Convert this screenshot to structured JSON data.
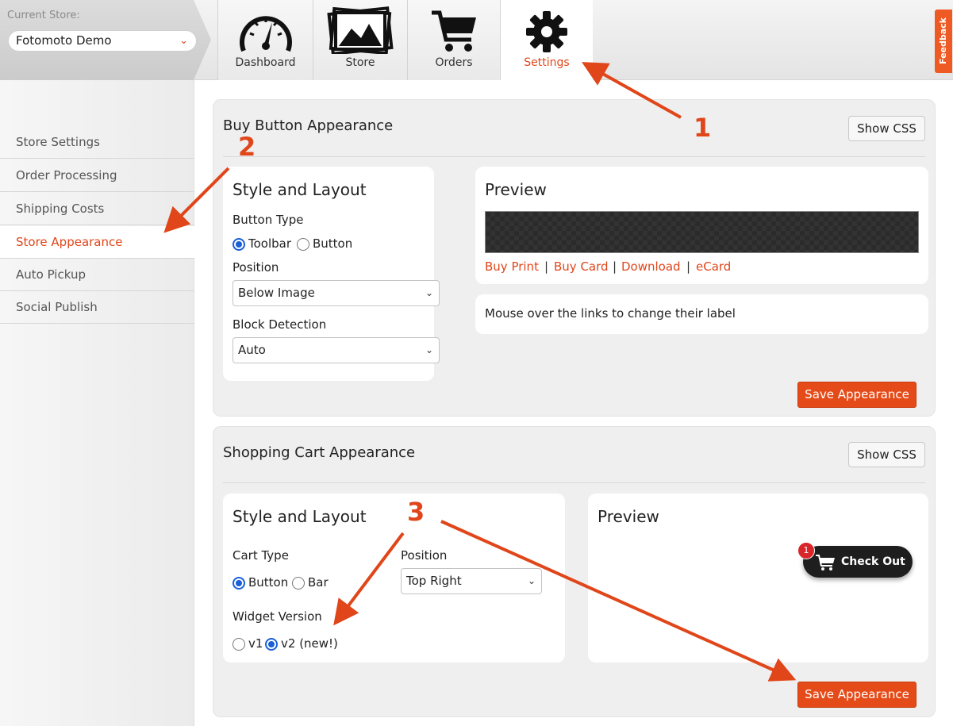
{
  "header": {
    "store_caption": "Current Store:",
    "store_name": "Fotomoto Demo",
    "tabs": [
      {
        "label": "Dashboard",
        "icon": "dashboard-gauge-icon"
      },
      {
        "label": "Store",
        "icon": "photos-icon"
      },
      {
        "label": "Orders",
        "icon": "cart-icon"
      },
      {
        "label": "Settings",
        "icon": "gear-icon"
      }
    ],
    "active_tab": "Settings",
    "feedback_label": "Feedback"
  },
  "sidebar": {
    "items": [
      {
        "label": "Store Settings"
      },
      {
        "label": "Order Processing"
      },
      {
        "label": "Shipping Costs"
      },
      {
        "label": "Store Appearance"
      },
      {
        "label": "Auto Pickup"
      },
      {
        "label": "Social Publish"
      }
    ],
    "active_item": "Store Appearance"
  },
  "buy_button": {
    "title": "Buy Button Appearance",
    "show_css_label": "Show CSS",
    "style_title": "Style and Layout",
    "button_type_label": "Button Type",
    "button_type_options": [
      "Toolbar",
      "Button"
    ],
    "button_type_selected": "Toolbar",
    "position_label": "Position",
    "position_value": "Below Image",
    "block_detection_label": "Block Detection",
    "block_detection_value": "Auto",
    "preview_title": "Preview",
    "preview_links": [
      "Buy Print",
      "Buy Card",
      "Download",
      "eCard"
    ],
    "link_separator": "|",
    "hint": "Mouse over the links to change their label",
    "save_label": "Save Appearance"
  },
  "cart": {
    "title": "Shopping Cart Appearance",
    "show_css_label": "Show CSS",
    "style_title": "Style and Layout",
    "cart_type_label": "Cart Type",
    "cart_type_options": [
      "Button",
      "Bar"
    ],
    "cart_type_selected": "Button",
    "position_label": "Position",
    "position_value": "Top Right",
    "widget_version_label": "Widget Version",
    "widget_version_options": [
      "v1",
      "v2 (new!)"
    ],
    "widget_version_selected": "v2 (new!)",
    "preview_title": "Preview",
    "checkout_label": "Check Out",
    "checkout_badge": "1",
    "save_label": "Save Appearance"
  },
  "annotations": {
    "step1": "1",
    "step2": "2",
    "step3": "3"
  },
  "colors": {
    "accent": "#e0461a",
    "button": "#e54b18",
    "radio": "#1a5fd6"
  }
}
